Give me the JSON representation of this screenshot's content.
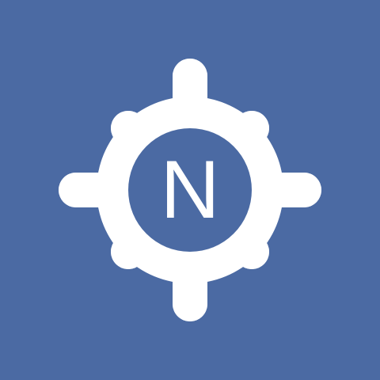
{
  "logo": {
    "letter": "N",
    "icon": "gear-icon",
    "colors": {
      "background": "#4b6aa3",
      "gear": "#ffffff",
      "letter": "#ffffff"
    }
  }
}
